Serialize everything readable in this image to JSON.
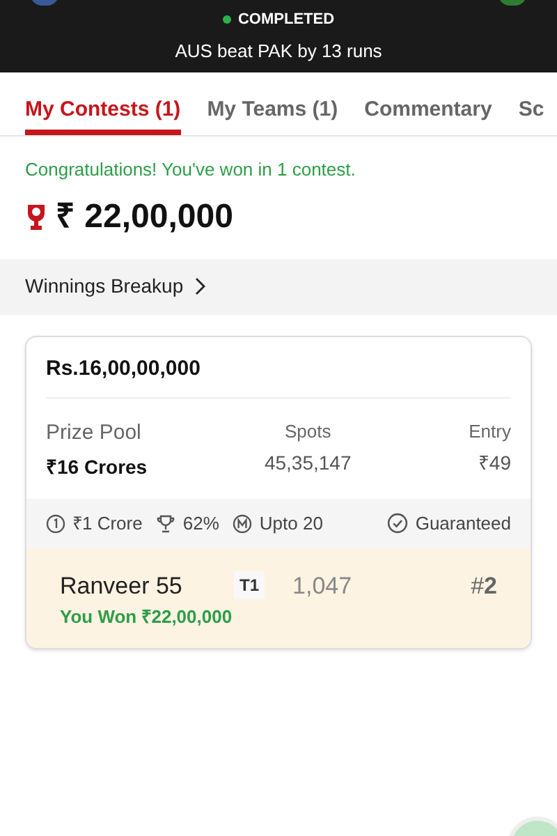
{
  "match": {
    "status": "COMPLETED",
    "result": "AUS beat PAK by 13 runs"
  },
  "tabs": [
    {
      "label": "My Contests (1)",
      "selected": true
    },
    {
      "label": "My Teams (1)",
      "selected": false
    },
    {
      "label": "Commentary",
      "selected": false
    },
    {
      "label": "Sc",
      "selected": false
    }
  ],
  "congrats": "Congratulations! You've won in 1 contest.",
  "total_winnings": "₹ 22,00,000",
  "breakup_link": "Winnings Breakup",
  "contest": {
    "title": "Rs.16,00,00,000",
    "stats": [
      {
        "label": "Prize Pool",
        "value": "₹16 Crores"
      },
      {
        "label": "Spots",
        "value": "45,35,147"
      },
      {
        "label": "Entry",
        "value": "₹49"
      }
    ],
    "features": [
      {
        "kind": "first",
        "text": "₹1 Crore"
      },
      {
        "kind": "trophy",
        "text": "62%"
      },
      {
        "kind": "multi",
        "text": "Upto 20"
      },
      {
        "kind": "check",
        "text": "Guaranteed"
      }
    ],
    "entry": {
      "name": "Ranveer 55",
      "team": "T1",
      "points": "1,047",
      "rank": "#**2**",
      "won": "You Won ₹22,00,000"
    }
  }
}
